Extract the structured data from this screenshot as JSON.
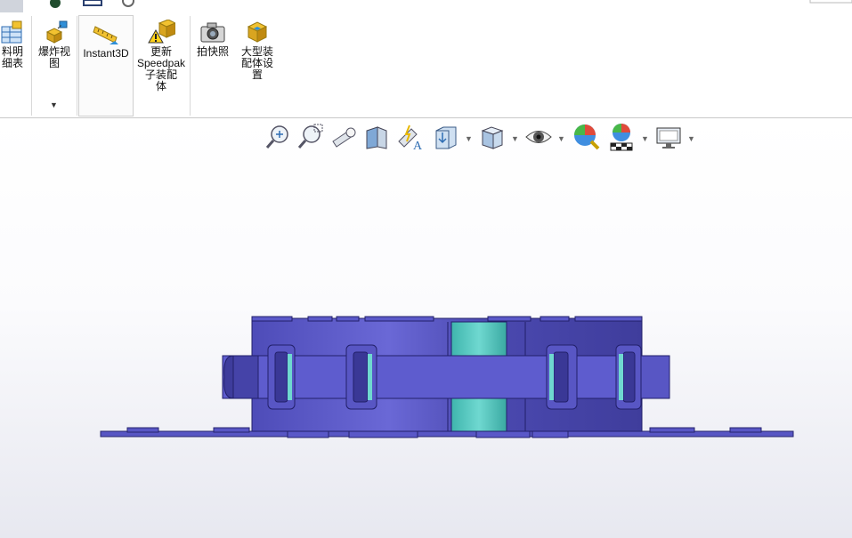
{
  "ribbon": {
    "bom_label": "料明\n细表",
    "explode_label": "爆炸视\n图",
    "instant3d_label": "Instant3D",
    "speedpak_label": "更新\nSpeedpak\n子装配\n体",
    "snapshot_label": "拍快照",
    "large_assembly_label": "大型装\n配体设\n置"
  },
  "colors": {
    "part_blue": "#5a58c8",
    "part_teal": "#55c6c0",
    "ribbon_bg": "#ffffff",
    "viewport_bottom": "#e7e8f0"
  },
  "hud_icons": [
    "zoom-to-fit-icon",
    "zoom-to-area-icon",
    "previous-view-icon",
    "section-view-icon",
    "dynamic-annotation-icon",
    "view-orientation-icon",
    "display-style-icon",
    "hide-show-items-icon",
    "edit-appearance-icon",
    "apply-scene-icon",
    "view-settings-icon"
  ]
}
